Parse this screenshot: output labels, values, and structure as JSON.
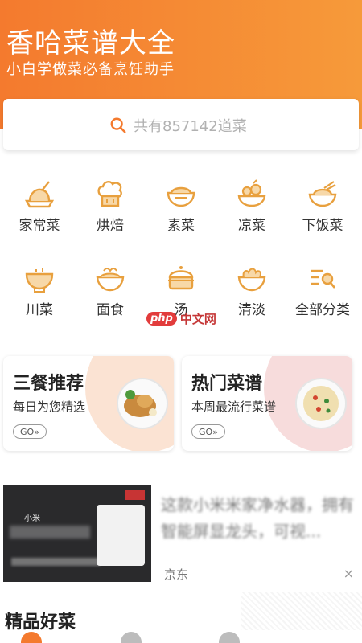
{
  "header": {
    "title": "香哈菜谱大全",
    "subtitle": "小白学做菜必备烹饪助手"
  },
  "search": {
    "placeholder": "共有857142道菜",
    "icon": "search-icon"
  },
  "categories": [
    {
      "label": "家常菜",
      "icon": "home-dish-icon"
    },
    {
      "label": "烘焙",
      "icon": "chef-hat-icon"
    },
    {
      "label": "素菜",
      "icon": "veg-bowl-icon"
    },
    {
      "label": "凉菜",
      "icon": "cold-dish-icon"
    },
    {
      "label": "下饭菜",
      "icon": "rice-bowl-icon"
    },
    {
      "label": "川菜",
      "icon": "pot-icon"
    },
    {
      "label": "面食",
      "icon": "noodles-icon"
    },
    {
      "label": "汤",
      "icon": "soup-icon"
    },
    {
      "label": "清淡",
      "icon": "light-dish-icon"
    },
    {
      "label": "全部分类",
      "icon": "list-search-icon"
    }
  ],
  "watermark": {
    "logo": "php",
    "text": "中文网"
  },
  "promos": [
    {
      "title": "三餐推荐",
      "desc": "每日为您精选",
      "go": "GO»"
    },
    {
      "title": "热门菜谱",
      "desc": "本周最流行菜谱",
      "go": "GO»"
    }
  ],
  "ad": {
    "text": "这款小米米家净水器，拥有智能屏显龙头，可视...",
    "source": "京东",
    "close": "×",
    "image_text": "小米"
  },
  "section": {
    "title": "精品好菜"
  },
  "colors": {
    "accent": "#f47a2e",
    "icon": "#e8a03e"
  }
}
